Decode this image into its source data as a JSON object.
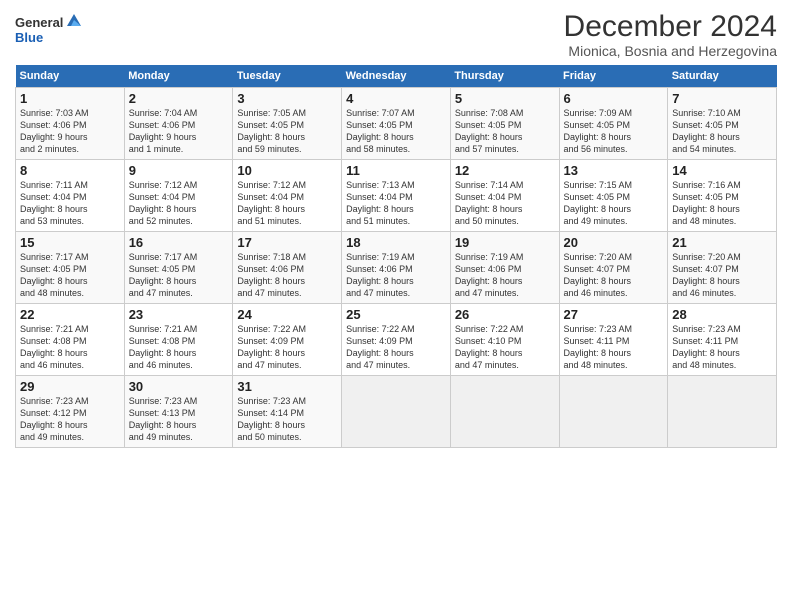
{
  "logo": {
    "general": "General",
    "blue": "Blue"
  },
  "title": "December 2024",
  "subtitle": "Mionica, Bosnia and Herzegovina",
  "days_header": [
    "Sunday",
    "Monday",
    "Tuesday",
    "Wednesday",
    "Thursday",
    "Friday",
    "Saturday"
  ],
  "weeks": [
    [
      {
        "day": "1",
        "info": "Sunrise: 7:03 AM\nSunset: 4:06 PM\nDaylight: 9 hours\nand 2 minutes."
      },
      {
        "day": "2",
        "info": "Sunrise: 7:04 AM\nSunset: 4:06 PM\nDaylight: 9 hours\nand 1 minute."
      },
      {
        "day": "3",
        "info": "Sunrise: 7:05 AM\nSunset: 4:05 PM\nDaylight: 8 hours\nand 59 minutes."
      },
      {
        "day": "4",
        "info": "Sunrise: 7:07 AM\nSunset: 4:05 PM\nDaylight: 8 hours\nand 58 minutes."
      },
      {
        "day": "5",
        "info": "Sunrise: 7:08 AM\nSunset: 4:05 PM\nDaylight: 8 hours\nand 57 minutes."
      },
      {
        "day": "6",
        "info": "Sunrise: 7:09 AM\nSunset: 4:05 PM\nDaylight: 8 hours\nand 56 minutes."
      },
      {
        "day": "7",
        "info": "Sunrise: 7:10 AM\nSunset: 4:05 PM\nDaylight: 8 hours\nand 54 minutes."
      }
    ],
    [
      {
        "day": "8",
        "info": "Sunrise: 7:11 AM\nSunset: 4:04 PM\nDaylight: 8 hours\nand 53 minutes."
      },
      {
        "day": "9",
        "info": "Sunrise: 7:12 AM\nSunset: 4:04 PM\nDaylight: 8 hours\nand 52 minutes."
      },
      {
        "day": "10",
        "info": "Sunrise: 7:12 AM\nSunset: 4:04 PM\nDaylight: 8 hours\nand 51 minutes."
      },
      {
        "day": "11",
        "info": "Sunrise: 7:13 AM\nSunset: 4:04 PM\nDaylight: 8 hours\nand 51 minutes."
      },
      {
        "day": "12",
        "info": "Sunrise: 7:14 AM\nSunset: 4:04 PM\nDaylight: 8 hours\nand 50 minutes."
      },
      {
        "day": "13",
        "info": "Sunrise: 7:15 AM\nSunset: 4:05 PM\nDaylight: 8 hours\nand 49 minutes."
      },
      {
        "day": "14",
        "info": "Sunrise: 7:16 AM\nSunset: 4:05 PM\nDaylight: 8 hours\nand 48 minutes."
      }
    ],
    [
      {
        "day": "15",
        "info": "Sunrise: 7:17 AM\nSunset: 4:05 PM\nDaylight: 8 hours\nand 48 minutes."
      },
      {
        "day": "16",
        "info": "Sunrise: 7:17 AM\nSunset: 4:05 PM\nDaylight: 8 hours\nand 47 minutes."
      },
      {
        "day": "17",
        "info": "Sunrise: 7:18 AM\nSunset: 4:06 PM\nDaylight: 8 hours\nand 47 minutes."
      },
      {
        "day": "18",
        "info": "Sunrise: 7:19 AM\nSunset: 4:06 PM\nDaylight: 8 hours\nand 47 minutes."
      },
      {
        "day": "19",
        "info": "Sunrise: 7:19 AM\nSunset: 4:06 PM\nDaylight: 8 hours\nand 47 minutes."
      },
      {
        "day": "20",
        "info": "Sunrise: 7:20 AM\nSunset: 4:07 PM\nDaylight: 8 hours\nand 46 minutes."
      },
      {
        "day": "21",
        "info": "Sunrise: 7:20 AM\nSunset: 4:07 PM\nDaylight: 8 hours\nand 46 minutes."
      }
    ],
    [
      {
        "day": "22",
        "info": "Sunrise: 7:21 AM\nSunset: 4:08 PM\nDaylight: 8 hours\nand 46 minutes."
      },
      {
        "day": "23",
        "info": "Sunrise: 7:21 AM\nSunset: 4:08 PM\nDaylight: 8 hours\nand 46 minutes."
      },
      {
        "day": "24",
        "info": "Sunrise: 7:22 AM\nSunset: 4:09 PM\nDaylight: 8 hours\nand 47 minutes."
      },
      {
        "day": "25",
        "info": "Sunrise: 7:22 AM\nSunset: 4:09 PM\nDaylight: 8 hours\nand 47 minutes."
      },
      {
        "day": "26",
        "info": "Sunrise: 7:22 AM\nSunset: 4:10 PM\nDaylight: 8 hours\nand 47 minutes."
      },
      {
        "day": "27",
        "info": "Sunrise: 7:23 AM\nSunset: 4:11 PM\nDaylight: 8 hours\nand 48 minutes."
      },
      {
        "day": "28",
        "info": "Sunrise: 7:23 AM\nSunset: 4:11 PM\nDaylight: 8 hours\nand 48 minutes."
      }
    ],
    [
      {
        "day": "29",
        "info": "Sunrise: 7:23 AM\nSunset: 4:12 PM\nDaylight: 8 hours\nand 49 minutes."
      },
      {
        "day": "30",
        "info": "Sunrise: 7:23 AM\nSunset: 4:13 PM\nDaylight: 8 hours\nand 49 minutes."
      },
      {
        "day": "31",
        "info": "Sunrise: 7:23 AM\nSunset: 4:14 PM\nDaylight: 8 hours\nand 50 minutes."
      },
      null,
      null,
      null,
      null
    ]
  ]
}
